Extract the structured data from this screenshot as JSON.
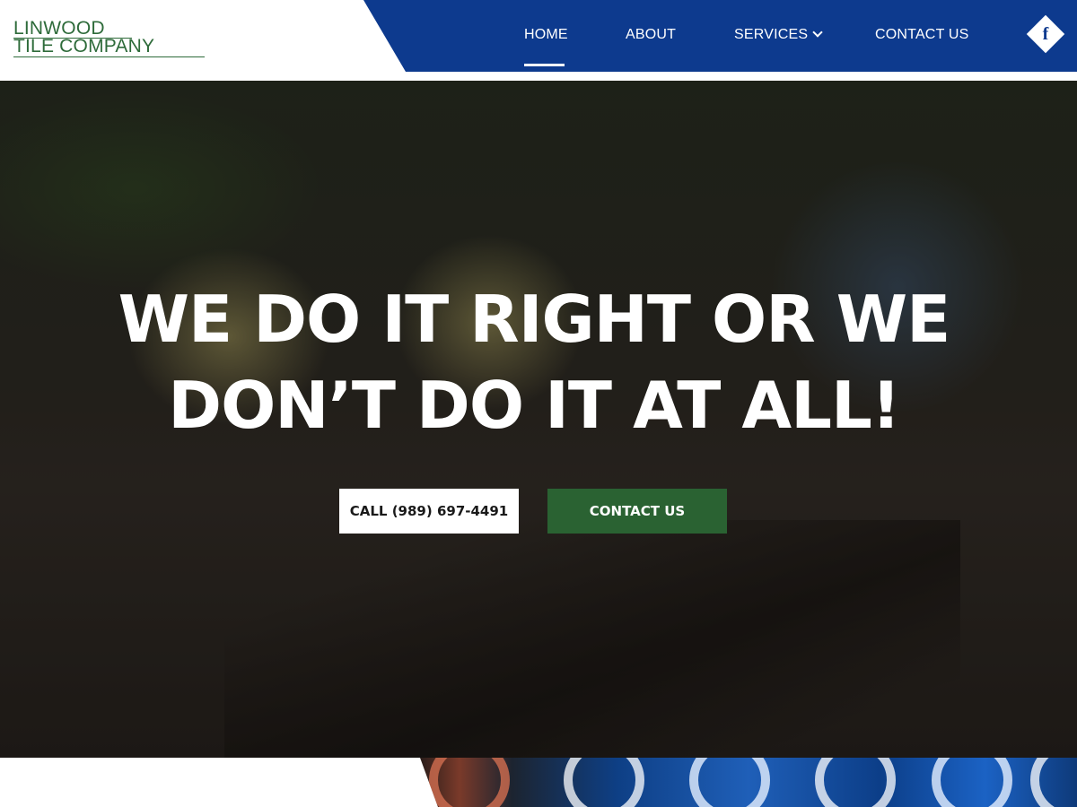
{
  "brand": {
    "line1": "LINWOOD",
    "line2": "TILE COMPANY",
    "color": "#2e6b3a"
  },
  "nav": {
    "background": "#0d3a8e",
    "items": [
      {
        "label": "HOME",
        "active": true
      },
      {
        "label": "ABOUT",
        "active": false
      },
      {
        "label": "SERVICES",
        "active": false,
        "has_dropdown": true
      },
      {
        "label": "CONTACT US",
        "active": false
      }
    ],
    "social": {
      "icon": "facebook-icon",
      "glyph": "f"
    }
  },
  "hero": {
    "headline_line1": "WE DO IT RIGHT OR WE",
    "headline_line2": "DON’T DO IT AT ALL!",
    "call_button": "CALL (989) 697-4491",
    "contact_button": "CONTACT US",
    "accent_green": "#2a6232"
  }
}
